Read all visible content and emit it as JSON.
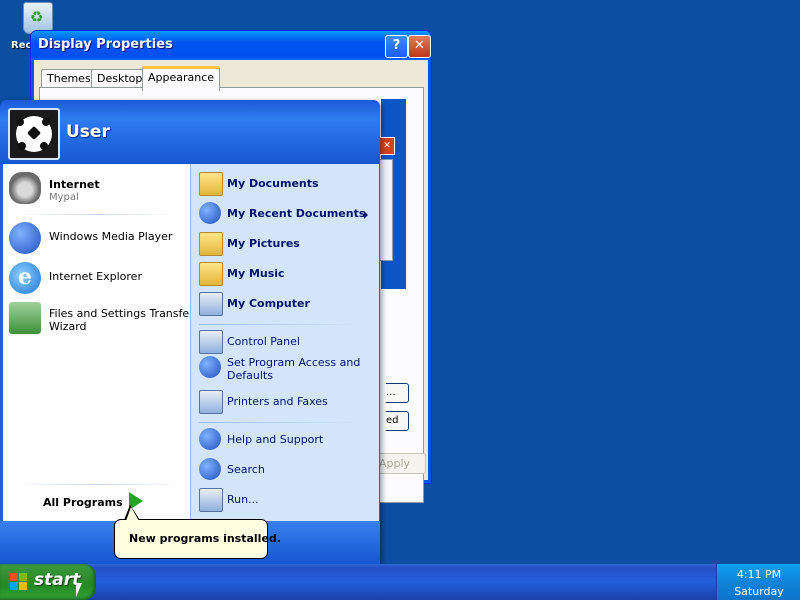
{
  "desktop": {
    "recycle_bin_label": "Rec"
  },
  "display_window": {
    "title": "Display Properties",
    "help_glyph": "?",
    "close_glyph": "✕",
    "tabs": [
      "Themes",
      "Desktop",
      "Appearance"
    ],
    "active_tab": "Appearance",
    "preview_close_glyph": "✕",
    "partial_button_1": "...",
    "partial_button_2": "ed",
    "apply_label": "Apply"
  },
  "start_menu": {
    "user_name": "User",
    "pinned": [
      {
        "title": "Internet",
        "subtitle": "Mypal",
        "icon": "raccoon-browser-icon"
      }
    ],
    "recent": [
      {
        "title": "Windows Media Player",
        "icon": "media-player-icon"
      },
      {
        "title": "Internet Explorer",
        "icon": "internet-explorer-icon"
      },
      {
        "title": "Files and Settings Transfer",
        "title_line2": "Wizard",
        "icon": "transfer-wizard-icon"
      }
    ],
    "all_programs": "All Programs",
    "places": [
      {
        "label": "My Documents",
        "icon": "my-documents-icon"
      },
      {
        "label": "My Recent Documents",
        "icon": "recent-documents-icon",
        "has_submenu": true
      },
      {
        "label": "My Pictures",
        "icon": "my-pictures-icon"
      },
      {
        "label": "My Music",
        "icon": "my-music-icon"
      },
      {
        "label": "My Computer",
        "icon": "my-computer-icon"
      }
    ],
    "system": [
      {
        "label": "Control Panel",
        "icon": "control-panel-icon"
      },
      {
        "label": "Set Program Access and",
        "label_line2": "Defaults",
        "icon": "program-access-icon"
      },
      {
        "label": "Printers and Faxes",
        "icon": "printer-icon"
      }
    ],
    "help": [
      {
        "label": "Help and Support",
        "icon": "help-icon"
      },
      {
        "label": "Search",
        "icon": "search-icon"
      },
      {
        "label": "Run...",
        "icon": "run-icon"
      }
    ]
  },
  "balloon": {
    "text": "New programs installed."
  },
  "taskbar": {
    "start_label": "start",
    "time": "4:11 PM",
    "day": "Saturday"
  },
  "colors": {
    "desktop": "#0b4ea2",
    "start_button": "#2e8b2e",
    "taskbar": "#245edb",
    "tray": "#0f84da"
  }
}
